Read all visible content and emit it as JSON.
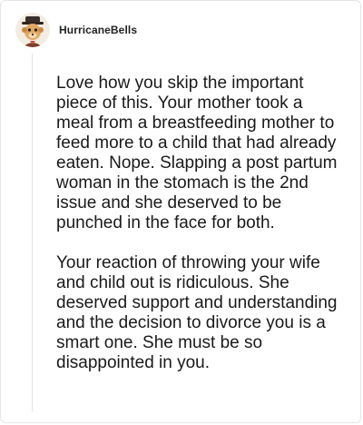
{
  "comment": {
    "author": {
      "username": "HurricaneBells",
      "avatar_icon": "cartoon-cowboy-avatar-icon"
    },
    "paragraphs": [
      "Love how you skip the important piece of this. Your mother took a meal from a breastfeeding mother to feed more to a child that had already eaten. Nope. Slapping a post partum woman in the stomach is the 2nd issue and she deserved to be punched in the face for both.",
      "Your reaction of throwing your wife and child out is ridiculous. She deserved support and understanding and the decision to divorce you is a smart one. She must be so disappointed in you."
    ]
  },
  "colors": {
    "text": "#1a1a1a",
    "border": "#e6e6e6",
    "thread_line": "#e2e2e2"
  }
}
